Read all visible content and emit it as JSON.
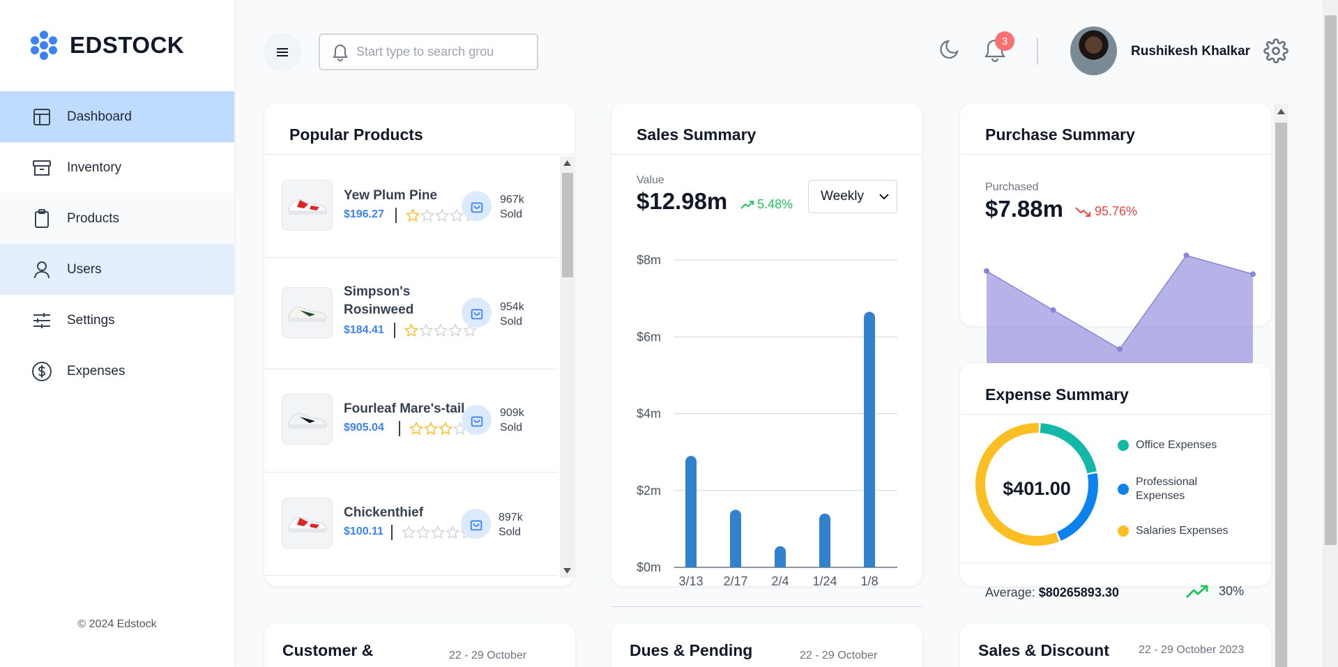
{
  "app": {
    "name": "EDSTOCK",
    "copyright": "© 2024 Edstock"
  },
  "sidebar": {
    "items": [
      {
        "label": "Dashboard",
        "icon": "layout-icon"
      },
      {
        "label": "Inventory",
        "icon": "archive-icon"
      },
      {
        "label": "Products",
        "icon": "clipboard-icon"
      },
      {
        "label": "Users",
        "icon": "user-icon"
      },
      {
        "label": "Settings",
        "icon": "sliders-icon"
      },
      {
        "label": "Expenses",
        "icon": "dollar-circle-icon"
      }
    ]
  },
  "topbar": {
    "search_placeholder": "Start type to search grou",
    "notification_count": "3",
    "username": "Rushikesh Khalkar"
  },
  "popular_products": {
    "title": "Popular Products",
    "items": [
      {
        "name": "Yew Plum Pine",
        "price": "$196.27",
        "rating": 1,
        "sold_count": "967k",
        "sold_label": "Sold"
      },
      {
        "name": "Simpson's Rosinweed",
        "price": "$184.41",
        "rating": 1,
        "sold_count": "954k",
        "sold_label": "Sold"
      },
      {
        "name": "Fourleaf Mare's-tail",
        "price": "$905.04",
        "rating": 3,
        "sold_count": "909k",
        "sold_label": "Sold"
      },
      {
        "name": "Chickenthief",
        "price": "$100.11",
        "rating": 0,
        "sold_count": "897k",
        "sold_label": "Sold"
      }
    ]
  },
  "sales_summary": {
    "title": "Sales Summary",
    "value_label": "Value",
    "value": "$12.98m",
    "change": "5.48%",
    "period": "Weekly"
  },
  "purchase_summary": {
    "title": "Purchase Summary",
    "label": "Purchased",
    "value": "$7.88m",
    "change": "95.76%"
  },
  "expense_summary": {
    "title": "Expense Summary",
    "total": "$401.00",
    "legend": [
      {
        "label": "Office Expenses",
        "color": "#14b8a6"
      },
      {
        "label": "Professional Expenses",
        "color": "#0b82f0"
      },
      {
        "label": "Salaries Expenses",
        "color": "#fbbf24"
      }
    ],
    "average_label": "Average:",
    "average_value": "$80265893.30",
    "trend": "30%"
  },
  "bottom_cards": [
    {
      "title": "Customer &",
      "date": "22 - 29 October"
    },
    {
      "title": "Dues & Pending",
      "date": "22 - 29 October"
    },
    {
      "title": "Sales & Discount",
      "date": "22 - 29 October 2023"
    }
  ],
  "chart_data": [
    {
      "type": "bar",
      "categories": [
        "3/13",
        "2/17",
        "2/4",
        "1/24",
        "1/8"
      ],
      "values": [
        2.9,
        1.5,
        0.55,
        1.4,
        6.65
      ],
      "ylim": [
        0,
        8
      ],
      "yticks": [
        "$0m",
        "$2m",
        "$4m",
        "$6m",
        "$8m"
      ],
      "grid": true,
      "color": "#3182ce"
    },
    {
      "type": "area",
      "values": [
        7.6,
        7.35,
        7.1,
        7.7,
        7.58
      ],
      "color": "#8884d8"
    },
    {
      "type": "pie",
      "categories": [
        "Office Expenses",
        "Professional Expenses",
        "Salaries Expenses"
      ],
      "values": [
        21,
        22,
        57
      ],
      "colors": [
        "#14b8a6",
        "#0b82f0",
        "#fbbf24"
      ]
    }
  ]
}
